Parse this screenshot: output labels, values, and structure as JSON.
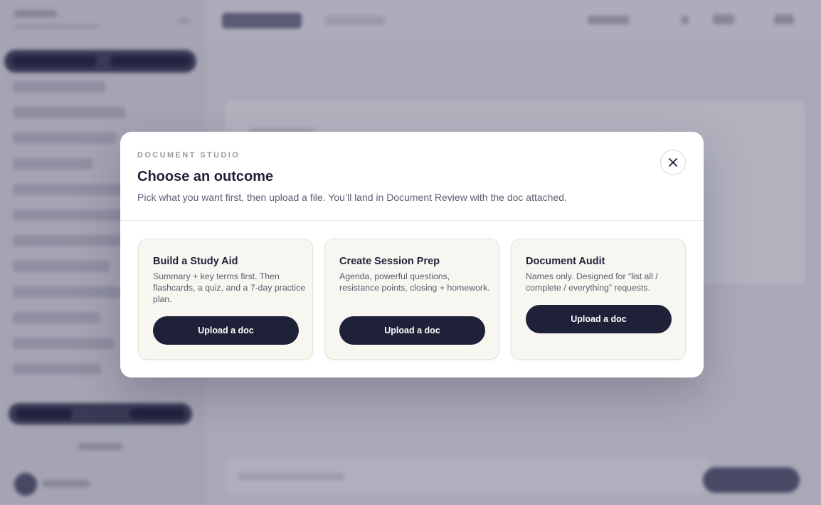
{
  "modal": {
    "eyebrow": "DOCUMENT STUDIO",
    "title": "Choose an outcome",
    "subtitle": "Pick what you want first, then upload a file. You’ll land in Document Review with the doc attached.",
    "close_icon": "close-icon"
  },
  "cards": [
    {
      "title": "Build a Study Aid",
      "description": "Summary + key terms first. Then flashcards, a quiz, and a 7-day practice plan.",
      "button_label": "Upload a doc"
    },
    {
      "title": "Create Session Prep",
      "description": "Agenda, powerful questions, resistance points, closing + homework.",
      "button_label": "Upload a doc"
    },
    {
      "title": "Document Audit",
      "description": "Names only. Designed for “list all / complete / everything” requests.",
      "button_label": "Upload a doc"
    }
  ],
  "colors": {
    "accent": "#1f2138",
    "card_bg": "#f8f6f0",
    "modal_bg": "#ffffff",
    "backdrop": "#b3b2bf"
  }
}
